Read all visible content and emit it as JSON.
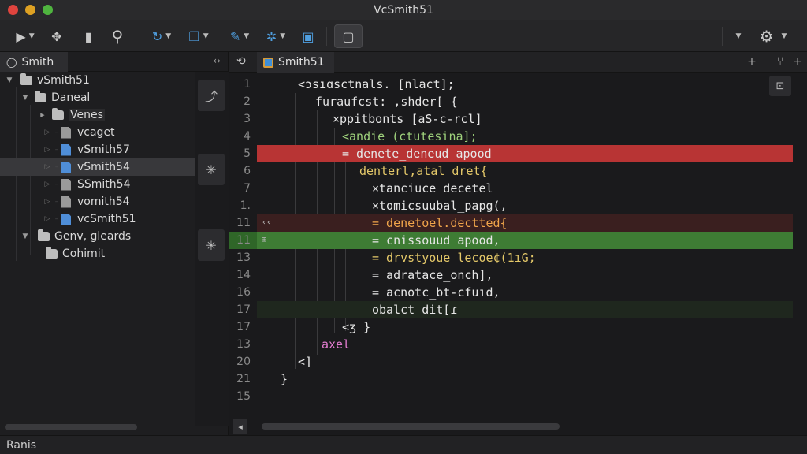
{
  "window": {
    "title": "VcSmith51"
  },
  "toolbar": {
    "buttons": [
      {
        "icon": "run-icon",
        "glyph": "▶"
      },
      {
        "icon": "move-icon",
        "glyph": "✥"
      },
      {
        "icon": "file-icon",
        "glyph": "▮"
      },
      {
        "icon": "search-icon",
        "glyph": "⚲"
      },
      {
        "icon": "sync-icon",
        "glyph": "↻"
      },
      {
        "icon": "copy-icon",
        "glyph": "❐"
      },
      {
        "icon": "pen-icon",
        "glyph": "✎"
      },
      {
        "icon": "puzzle-icon",
        "glyph": "✲"
      },
      {
        "icon": "document-icon",
        "glyph": "▣"
      },
      {
        "icon": "image-icon",
        "glyph": "▢"
      },
      {
        "icon": "gear-icon",
        "glyph": "⚙"
      }
    ]
  },
  "sidebar": {
    "tab_label": "Smith",
    "tab_icon": "◯",
    "menu_glyph": "‹›",
    "tree": [
      {
        "label": "vSmith51",
        "type": "folder",
        "depth": 0,
        "arrow": "open"
      },
      {
        "label": "Daneal",
        "type": "folder",
        "depth": 1,
        "arrow": "open"
      },
      {
        "label": "Venes",
        "type": "folder",
        "depth": 2,
        "arrow": "closed"
      },
      {
        "label": "vcaget",
        "type": "file",
        "depth": 3,
        "color": "gray"
      },
      {
        "label": "vSmith57",
        "type": "file",
        "depth": 3,
        "color": "blue"
      },
      {
        "label": "vSmith54",
        "type": "file",
        "depth": 3,
        "color": "blue",
        "selected": true
      },
      {
        "label": "SSmith54",
        "type": "file",
        "depth": 3,
        "color": "gray"
      },
      {
        "label": "vomith54",
        "type": "file",
        "depth": 3,
        "color": "gray"
      },
      {
        "label": "vcSmith51",
        "type": "file",
        "depth": 3,
        "color": "blue"
      },
      {
        "label": "Genv, gleards",
        "type": "folder",
        "depth": 1,
        "arrow": "open"
      },
      {
        "label": "Cohimit",
        "type": "folder",
        "depth": 2
      }
    ]
  },
  "editor": {
    "tab_label": "Smith51",
    "back_glyph": "⟲",
    "actions": [
      "+",
      "⑂",
      "+"
    ],
    "side_button_glyph": "⊡",
    "lines": [
      {
        "n": "1",
        "text": "<ɔsıɑsctnals. [nlact];",
        "indent": 52,
        "color": "c-white"
      },
      {
        "n": "2",
        "text": "furaufcst: ,shder[ {",
        "indent": 74,
        "color": "c-white"
      },
      {
        "n": "3",
        "text": "×ppitbonts [aS-c-rcl]",
        "indent": 96,
        "color": "c-white"
      },
      {
        "n": "4",
        "text": "<andie (ctutesina];",
        "indent": 108,
        "color": "c-green"
      },
      {
        "n": "5",
        "text": "= denete_deneud apood",
        "indent": 108,
        "color": "c-white",
        "state": "del"
      },
      {
        "n": "6",
        "text": "denterl,atal dret{",
        "indent": 130,
        "color": "c-yellow"
      },
      {
        "n": "7",
        "text": "×tanciuce decetel",
        "indent": 146,
        "color": "c-white"
      },
      {
        "n": "1.",
        "text": "×tomicsuubal_papg(,",
        "indent": 146,
        "color": "c-white"
      },
      {
        "n": "11",
        "text": "= denetoel.dectted{",
        "indent": 146,
        "color": "c-orange",
        "state": "soft",
        "mark": "‹‹"
      },
      {
        "n": "11",
        "text": "= cnissouud apood,",
        "indent": 146,
        "color": "c-white",
        "state": "add",
        "mark": "⊞"
      },
      {
        "n": "13",
        "text": "= drvstyoue lecoe¢(1ıG;",
        "indent": 146,
        "color": "c-yellow"
      },
      {
        "n": "14",
        "text": "= adratace_onch],",
        "indent": 146,
        "color": "c-white"
      },
      {
        "n": "16",
        "text": "= acnotc_bt-cfuıd,",
        "indent": 146,
        "color": "c-white"
      },
      {
        "n": "17",
        "text": "obalct dit[ɾ",
        "indent": 146,
        "color": "c-white",
        "state": "fade"
      },
      {
        "n": "17",
        "text": "<ʒ }",
        "indent": 108,
        "color": "c-white"
      },
      {
        "n": "13",
        "text": "axel",
        "indent": 82,
        "color": "c-pink"
      },
      {
        "n": "20",
        "text": "<]",
        "indent": 52,
        "color": "c-white"
      },
      {
        "n": "21",
        "text": "}",
        "indent": 30,
        "color": "c-white"
      },
      {
        "n": "15",
        "text": "",
        "indent": 30,
        "color": "c-white"
      }
    ]
  },
  "status": {
    "text": "Ranis"
  },
  "colors": {
    "close": "#e0443e",
    "minimize": "#dea123",
    "maximize": "#4fb43f",
    "deleted_line": "#b83434",
    "added_line": "#3e7c34",
    "accent": "#4f8ed8"
  }
}
